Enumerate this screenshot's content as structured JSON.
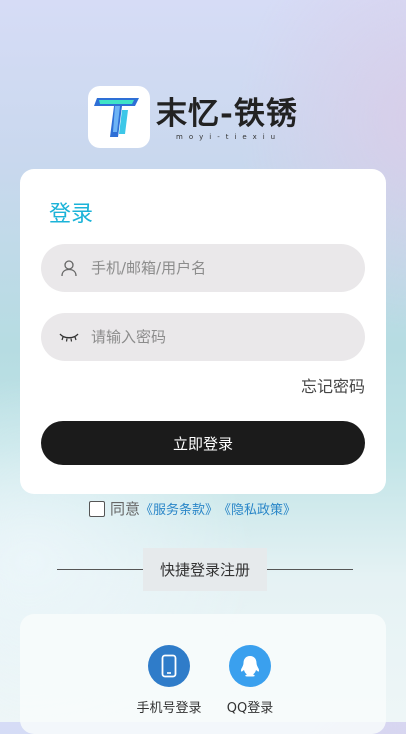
{
  "brand": {
    "title": "末忆-铁锈",
    "subtitle": "moyi-tiexiu"
  },
  "login": {
    "title": "登录",
    "username_placeholder": "手机/邮箱/用户名",
    "password_placeholder": "请输入密码",
    "forgot_label": "忘记密码",
    "submit_label": "立即登录"
  },
  "agreement": {
    "prefix": "同意",
    "service_terms": "《服务条款》",
    "privacy_policy": "《隐私政策》",
    "checked": false
  },
  "quick_login": {
    "divider_label": "快捷登录注册",
    "methods": [
      {
        "label": "手机号登录",
        "icon": "phone-icon",
        "color": "#2f7cc9"
      },
      {
        "label": "QQ登录",
        "icon": "qq-icon",
        "color": "#3aa0ee"
      }
    ]
  },
  "colors": {
    "accent": "#1bb3d8",
    "button": "#1b1b1b",
    "link": "#2a86c8"
  }
}
